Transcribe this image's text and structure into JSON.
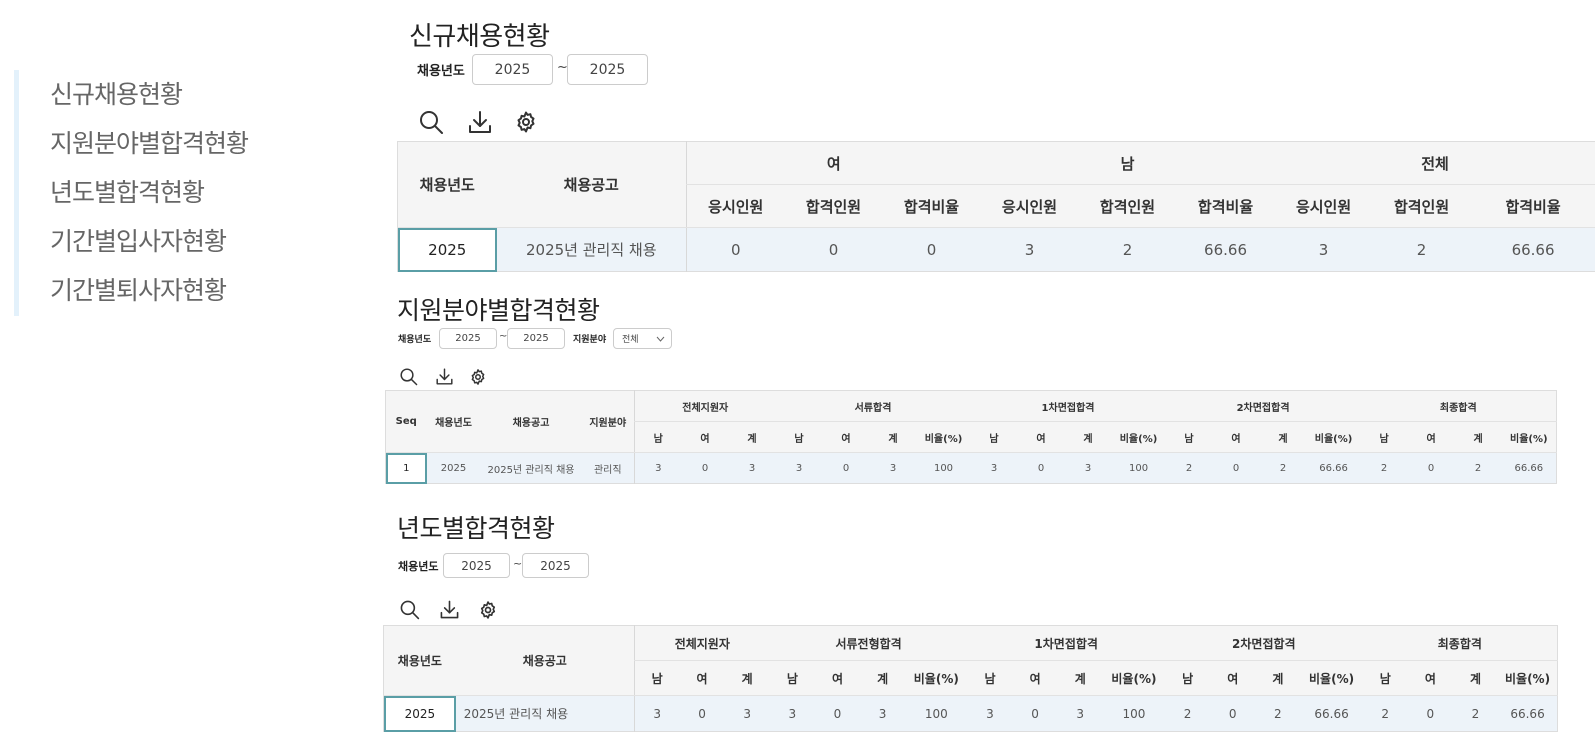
{
  "sidebar": {
    "items": [
      "신규채용현황",
      "지원분야별합격현황",
      "년도별합격현황",
      "기간별입사자현황",
      "기간별퇴사자현황"
    ]
  },
  "icons": [
    "search-icon",
    "download-icon",
    "gear-icon"
  ],
  "section1": {
    "title": "신규채용현황",
    "filter": {
      "label": "채용년도",
      "from": "2025",
      "to": "2025",
      "sep": "~"
    },
    "headers": {
      "year": "채용년도",
      "notice": "채용공고",
      "groups": [
        "여",
        "남",
        "전체"
      ],
      "subs": [
        "응시인원",
        "합격인원",
        "합격비율"
      ]
    },
    "row": {
      "year": "2025",
      "notice": "2025년 관리직 채용",
      "values": [
        "0",
        "0",
        "0",
        "3",
        "2",
        "66.66",
        "3",
        "2",
        "66.66"
      ]
    }
  },
  "section2": {
    "title": "지원분야별합격현황",
    "filter": {
      "label": "채용년도",
      "from": "2025",
      "to": "2025",
      "sep": "~",
      "field_label": "지원분야",
      "field_value": "전체"
    },
    "headers": {
      "seq": "Seq",
      "year": "채용년도",
      "notice": "채용공고",
      "field": "지원분야",
      "groups": [
        "전체지원자",
        "서류합격",
        "1차면접합격",
        "2차면접합격",
        "최종합격"
      ],
      "subs3": [
        "남",
        "여",
        "계"
      ],
      "subs4": [
        "남",
        "여",
        "계",
        "비율(%)"
      ]
    },
    "row": {
      "seq": "1",
      "year": "2025",
      "notice": "2025년 관리직 채용",
      "field": "관리직",
      "values": [
        "3",
        "0",
        "3",
        "3",
        "0",
        "3",
        "100",
        "3",
        "0",
        "3",
        "100",
        "2",
        "0",
        "2",
        "66.66",
        "2",
        "0",
        "2",
        "66.66"
      ]
    }
  },
  "section3": {
    "title": "년도별합격현황",
    "filter": {
      "label": "채용년도",
      "from": "2025",
      "to": "2025",
      "sep": "~"
    },
    "headers": {
      "year": "채용년도",
      "notice": "채용공고",
      "groups": [
        "전체지원자",
        "서류전형합격",
        "1차면접합격",
        "2차면접합격",
        "최종합격"
      ],
      "subs3": [
        "남",
        "여",
        "계"
      ],
      "subs4": [
        "남",
        "여",
        "계",
        "비율(%)"
      ]
    },
    "row": {
      "year": "2025",
      "notice": "2025년 관리직 채용",
      "values": [
        "3",
        "0",
        "3",
        "3",
        "0",
        "3",
        "100",
        "3",
        "0",
        "3",
        "100",
        "2",
        "0",
        "2",
        "66.66",
        "2",
        "0",
        "2",
        "66.66"
      ]
    }
  }
}
